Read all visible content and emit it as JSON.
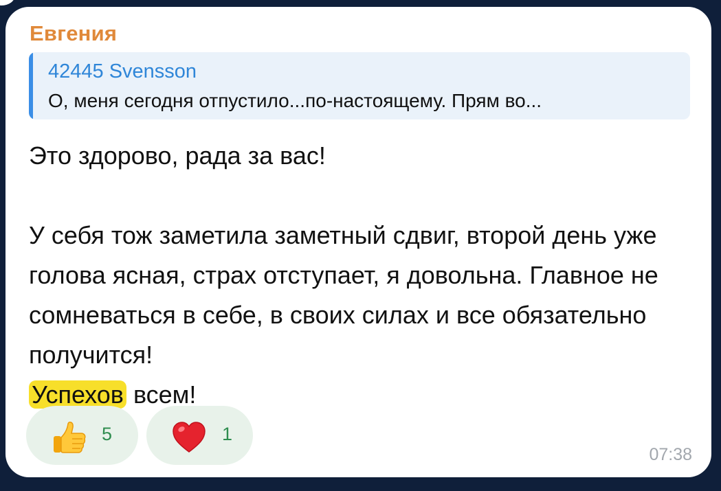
{
  "message": {
    "sender": "Евгения",
    "reply": {
      "author": "42445 Svensson",
      "text": "О, меня сегодня отпустило...по-настоящему. Прям во..."
    },
    "body": {
      "line1": "Это здорово, рада за вас!",
      "paragraph2": "У себя тож заметила заметный сдвиг, второй день уже голова ясная, страх отступает, я довольна. Главное не сомневаться в себе, в своих силах и все обязательно получится!",
      "highlight_word": "Успехов",
      "highlight_tail": " всем!"
    },
    "reactions": [
      {
        "icon": "thumbs-up-icon",
        "count": "5"
      },
      {
        "icon": "heart-icon",
        "count": "1"
      }
    ],
    "time": "07:38"
  },
  "colors": {
    "sender": "#e0893a",
    "reply_accent": "#3a8ee6",
    "highlight": "#f7df2a",
    "reaction_count": "#2f8d4f",
    "background": "#0f1f3a"
  }
}
